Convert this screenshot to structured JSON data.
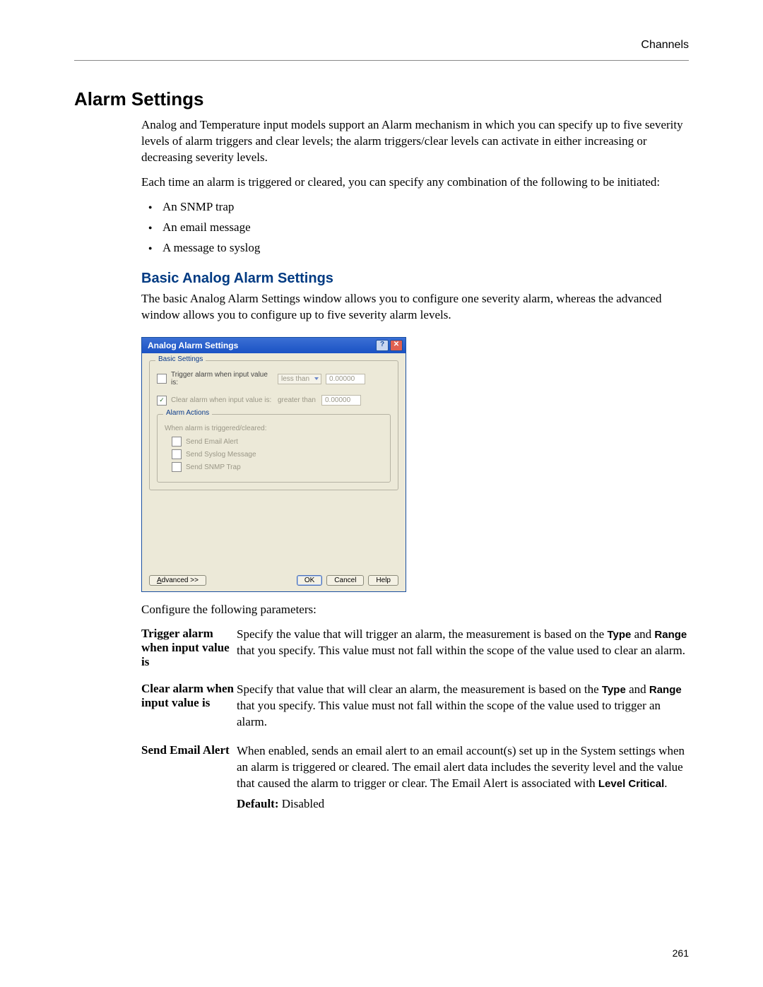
{
  "header": {
    "section": "Channels"
  },
  "page_number": "261",
  "h2": "Alarm Settings",
  "intro1": "Analog and Temperature input models support an Alarm mechanism in which you can specify up to five severity levels of alarm triggers and clear levels; the alarm triggers/clear levels can activate in either increasing or decreasing severity levels.",
  "intro2": "Each time an alarm is triggered or cleared, you can specify any combination of the following to be initiated:",
  "bullets": [
    "An SNMP trap",
    "An email message",
    "A message to syslog"
  ],
  "h3": "Basic Analog Alarm Settings",
  "sub_intro": "The basic Analog Alarm Settings window allows you to configure one severity alarm, whereas the advanced window allows you to configure up to five severity alarm levels.",
  "dialog": {
    "title": "Analog Alarm Settings",
    "help_icon": "?",
    "close_icon": "✕",
    "basic_legend": "Basic Settings",
    "trigger_label": "Trigger alarm when input value is:",
    "trigger_op": "less than",
    "trigger_val": "0.00000",
    "clear_label": "Clear alarm when input value is:",
    "clear_op": "greater than",
    "clear_val": "0.00000",
    "actions_legend": "Alarm Actions",
    "actions_hint": "When alarm is triggered/cleared:",
    "opt_email": "Send Email Alert",
    "opt_syslog": "Send Syslog Message",
    "opt_snmp": "Send SNMP Trap",
    "btn_advanced": "Advanced >>",
    "btn_ok": "OK",
    "btn_cancel": "Cancel",
    "btn_help": "Help"
  },
  "configure_prompt": "Configure the following parameters:",
  "params": [
    {
      "name": "Trigger alarm when input value is",
      "desc_pre": "Specify the value that will trigger an alarm, the measurement is based on the ",
      "b1": "Type",
      "mid1": " and ",
      "b2": "Range",
      "desc_post": " that you specify. This value must not fall within the scope of the value used to clear an alarm."
    },
    {
      "name": "Clear alarm when input value is",
      "desc_pre": "Specify that value that will clear an alarm, the measurement is based on the ",
      "b1": "Type",
      "mid1": " and ",
      "b2": "Range",
      "desc_post": " that you specify. This value must not fall within the scope of the value used to trigger an alarm."
    },
    {
      "name": "Send Email Alert",
      "desc_pre": "When enabled, sends an email alert to an email account(s) set up in the System settings when an alarm is triggered or cleared. The email alert data includes the severity level and the value that caused the alarm to trigger or clear. The Email Alert is associated with ",
      "b1": "Level Critical",
      "mid1": ".",
      "b2": "",
      "desc_post": "",
      "default_label": "Default:",
      "default_value": " Disabled"
    }
  ]
}
